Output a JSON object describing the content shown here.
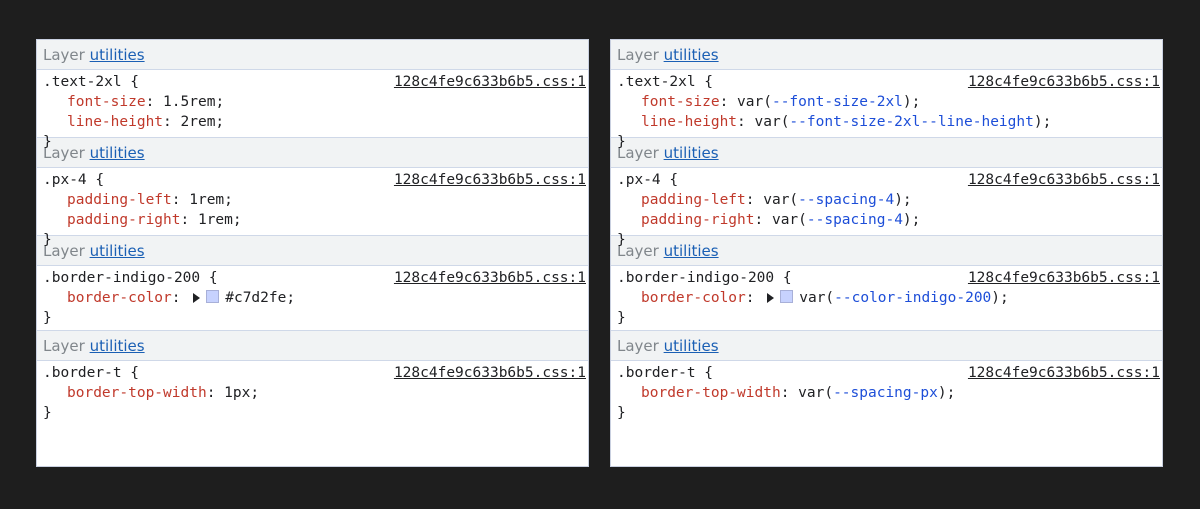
{
  "colors": {
    "swatch_indigo_200": "#c7d2fe"
  },
  "panels": [
    {
      "rules": [
        {
          "layer_prefix": "Layer",
          "layer_link": "utilities",
          "selector": ".text-2xl {",
          "source": "128c4fe9c633b6b5.css:1",
          "decls": [
            {
              "prop": "font-size",
              "value": "1.5rem"
            },
            {
              "prop": "line-height",
              "value": "2rem"
            }
          ]
        },
        {
          "layer_prefix": "Layer",
          "layer_link": "utilities",
          "selector": ".px-4 {",
          "source": "128c4fe9c633b6b5.css:1",
          "decls": [
            {
              "prop": "padding-left",
              "value": "1rem"
            },
            {
              "prop": "padding-right",
              "value": "1rem"
            }
          ]
        },
        {
          "layer_prefix": "Layer",
          "layer_link": "utilities",
          "selector": ".border-indigo-200 {",
          "source": "128c4fe9c633b6b5.css:1",
          "decls": [
            {
              "prop": "border-color",
              "value": "#c7d2fe",
              "swatch": true
            }
          ]
        },
        {
          "layer_prefix": "Layer",
          "layer_link": "utilities",
          "selector": ".border-t {",
          "source": "128c4fe9c633b6b5.css:1",
          "decls": [
            {
              "prop": "border-top-width",
              "value": "1px"
            }
          ]
        }
      ]
    },
    {
      "rules": [
        {
          "layer_prefix": "Layer",
          "layer_link": "utilities",
          "selector": ".text-2xl {",
          "source": "128c4fe9c633b6b5.css:1",
          "decls": [
            {
              "prop": "font-size",
              "var_name": "--font-size-2xl"
            },
            {
              "prop": "line-height",
              "var_name": "--font-size-2xl--line-height"
            }
          ]
        },
        {
          "layer_prefix": "Layer",
          "layer_link": "utilities",
          "selector": ".px-4 {",
          "source": "128c4fe9c633b6b5.css:1",
          "decls": [
            {
              "prop": "padding-left",
              "var_name": "--spacing-4"
            },
            {
              "prop": "padding-right",
              "var_name": "--spacing-4"
            }
          ]
        },
        {
          "layer_prefix": "Layer",
          "layer_link": "utilities",
          "selector": ".border-indigo-200 {",
          "source": "128c4fe9c633b6b5.css:1",
          "decls": [
            {
              "prop": "border-color",
              "var_name": "--color-indigo-200",
              "swatch": true
            }
          ]
        },
        {
          "layer_prefix": "Layer",
          "layer_link": "utilities",
          "selector": ".border-t {",
          "source": "128c4fe9c633b6b5.css:1",
          "decls": [
            {
              "prop": "border-top-width",
              "var_name": "--spacing-px"
            }
          ]
        }
      ]
    }
  ]
}
